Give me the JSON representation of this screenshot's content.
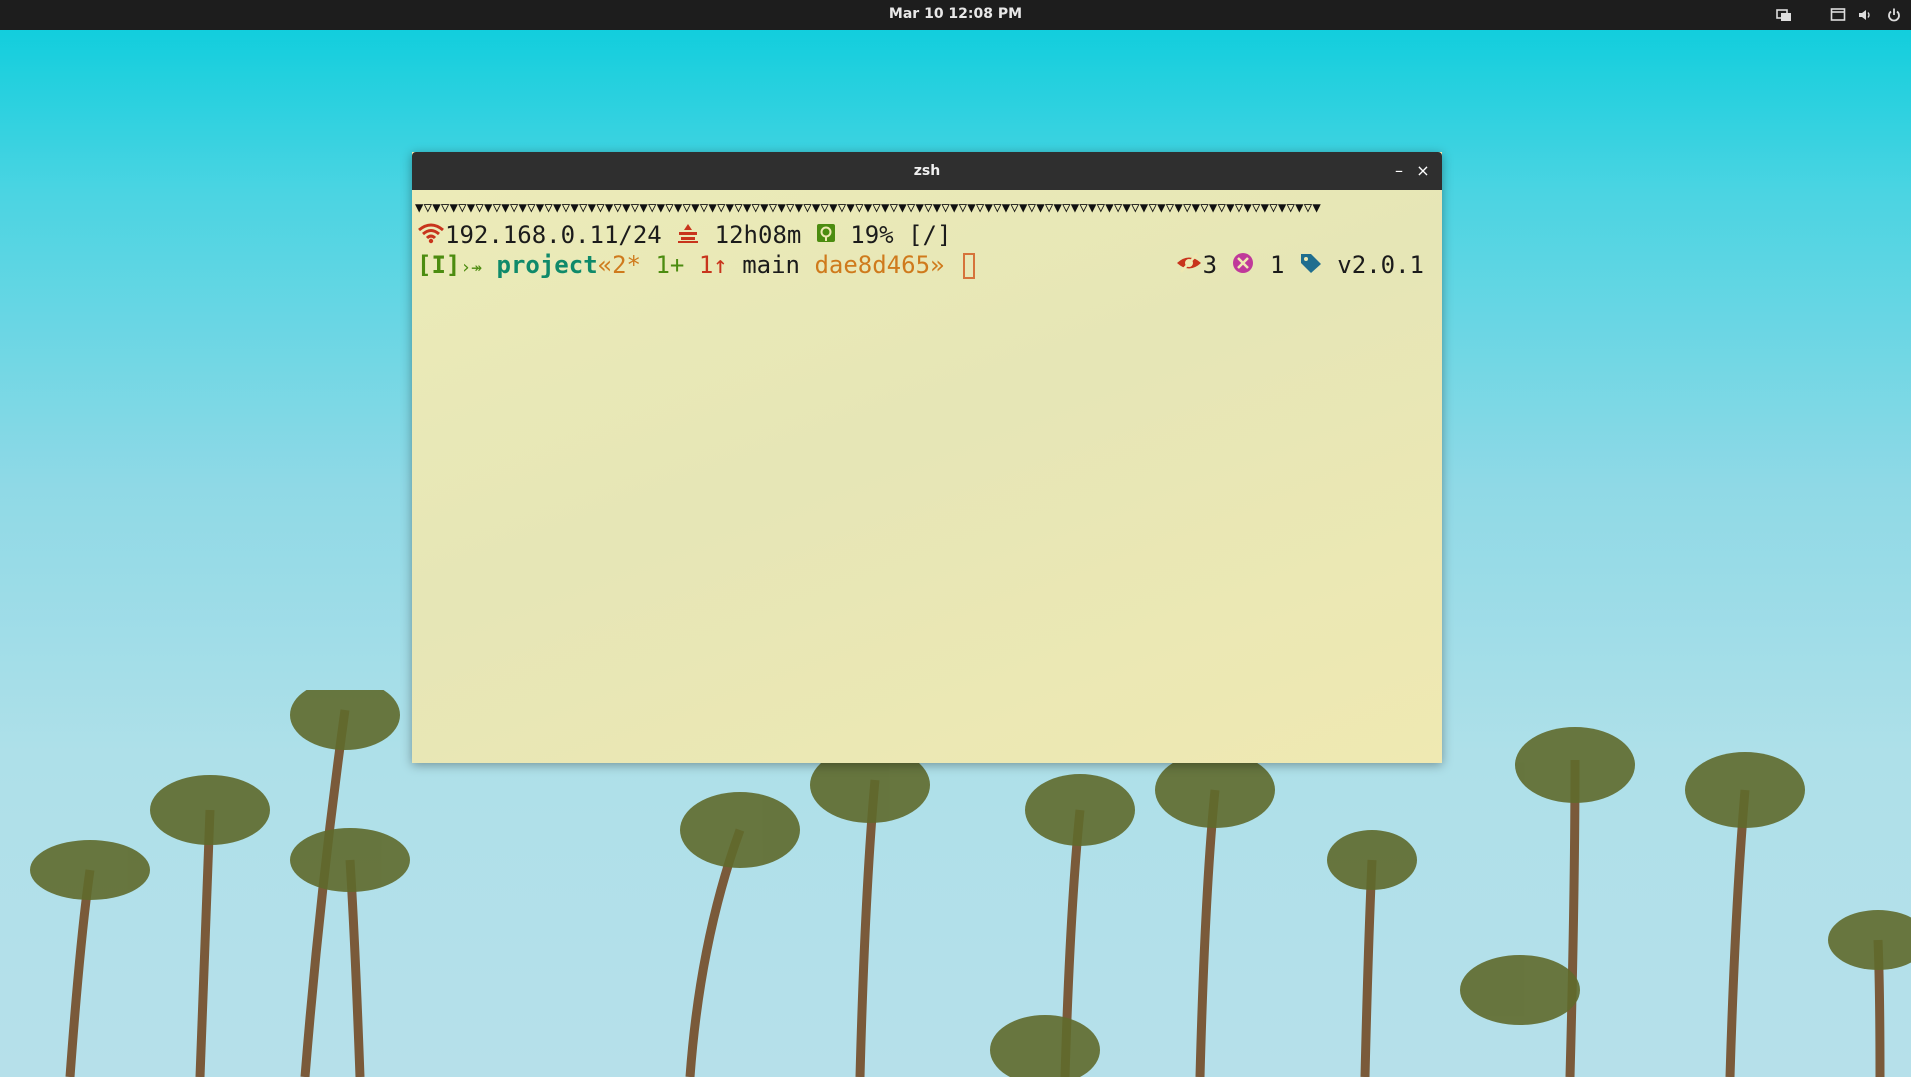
{
  "topbar": {
    "clock": "Mar 10  12:08 PM",
    "icons": [
      "notifications-icon",
      "screen-icon",
      "volume-icon",
      "power-icon"
    ]
  },
  "window": {
    "title": "zsh",
    "minimize_label": "–",
    "close_label": "×"
  },
  "terminal": {
    "separator": "▼▽▼▽▼▽▼▽▼▽▼▽▼▽▼▽▼▽▼▽▼▽▼▽▼▽▼▽▼▽▼▽▼▽▼▽▼▽▼▽▼▽▼▽▼▽▼▽▼▽▼▽▼▽▼▽▼▽▼▽▼▽▼▽▼▽▼▽▼▽▼▽▼▽▼▽▼▽▼▽▼▽▼▽▼▽▼▽▼▽▼▽▼▽▼▽▼▽▼▽▼▽▼▽▼",
    "ip": "192.168.0.11/24",
    "uptime": "12h08m",
    "disk": "19%",
    "dir": "[/]",
    "mode": "[I]",
    "arrows": "›↠",
    "repo": "project",
    "git_open": "«",
    "modified": "2*",
    "staged": "1+",
    "ahead": "1↑",
    "branch": "main",
    "commit": "dae8d465",
    "git_close": "»",
    "stashes": "3",
    "conflicts": "1",
    "tag": "v2.0.1",
    "colors": {
      "red": "#c8341c",
      "green": "#4c8c10",
      "teal": "#0f8a6a",
      "orange": "#cf7a1c",
      "magenta": "#c0399a",
      "blue": "#1f6e8f"
    }
  }
}
